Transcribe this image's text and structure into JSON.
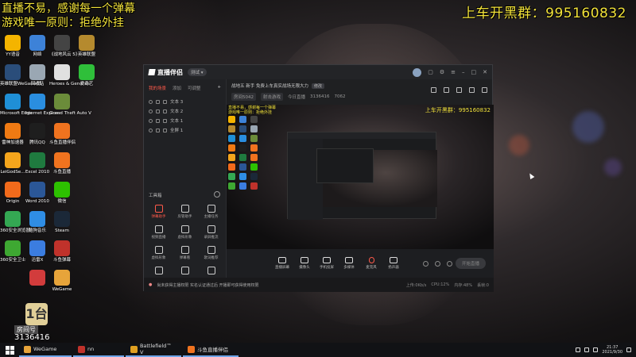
{
  "overlay": {
    "line1": "直播不易，感谢每一个弹幕",
    "line2": "游戏唯一原则：拒绝外挂",
    "group": "上车开黑群：995160832"
  },
  "desktop_icons": [
    {
      "label": "YY语音",
      "icon": "yy-icon",
      "color": "#f4b400"
    },
    {
      "label": "网络",
      "icon": "network-icon",
      "color": "#3d82d8"
    },
    {
      "label": "《战地风云 5》",
      "icon": "bf5-icon",
      "color": "#444444"
    },
    {
      "label": "英雄联盟",
      "icon": "lol-icon",
      "color": "#b58a2e"
    },
    {
      "label": "英雄联盟WeGame版",
      "icon": "lol-wegame-icon",
      "color": "#2a4d7a"
    },
    {
      "label": "回收站",
      "icon": "recycle-bin-icon",
      "color": "#9aa7b3"
    },
    {
      "label": "Heroes & Generals",
      "icon": "hg-icon",
      "color": "#e0e0e0"
    },
    {
      "label": "爱奇艺",
      "icon": "iqiyi-icon",
      "color": "#2fbf3a"
    },
    {
      "label": "Microsoft Edge",
      "icon": "edge-icon",
      "color": "#1f8fd6"
    },
    {
      "label": "Internet Explorer",
      "icon": "ie-icon",
      "color": "#2a8ee0"
    },
    {
      "label": "Grand Theft Auto V",
      "icon": "gta-icon",
      "color": "#6b8c3a"
    },
    {
      "label": "",
      "icon": "blank-icon",
      "color": "rgba(0,0,0,0)"
    },
    {
      "label": "雷神加速器",
      "icon": "leishen-icon",
      "color": "#f07a13"
    },
    {
      "label": "腾讯QQ",
      "icon": "qq-icon",
      "color": "#1e1e1e"
    },
    {
      "label": "斗鱼直播伴侣",
      "icon": "douyu-companion-icon",
      "color": "#f0731f"
    },
    {
      "label": "",
      "icon": "blank-icon",
      "color": "rgba(0,0,0,0)"
    },
    {
      "label": "LeiGodSe...",
      "icon": "leigod-icon",
      "color": "#f5a51c"
    },
    {
      "label": "Excel 2010",
      "icon": "excel-icon",
      "color": "#1f7a3f"
    },
    {
      "label": "斗鱼直播",
      "icon": "douyu-icon",
      "color": "#f0731f"
    },
    {
      "label": "",
      "icon": "blank-icon",
      "color": "rgba(0,0,0,0)"
    },
    {
      "label": "Origin",
      "icon": "origin-icon",
      "color": "#f26a1b"
    },
    {
      "label": "Word 2010",
      "icon": "word-icon",
      "color": "#2b5797"
    },
    {
      "label": "微信",
      "icon": "wechat-icon",
      "color": "#2dc100"
    },
    {
      "label": "",
      "icon": "blank-icon",
      "color": "rgba(0,0,0,0)"
    },
    {
      "label": "360安全浏览器",
      "icon": "360browser-icon",
      "color": "#34a853"
    },
    {
      "label": "酷狗音乐",
      "icon": "kugou-icon",
      "color": "#2f8de4"
    },
    {
      "label": "Steam",
      "icon": "steam-icon",
      "color": "#1b2838"
    },
    {
      "label": "",
      "icon": "blank-icon",
      "color": "rgba(0,0,0,0)"
    },
    {
      "label": "360安全卫士",
      "icon": "360safe-icon",
      "color": "#3ea832"
    },
    {
      "label": "迅雷X",
      "icon": "xunlei-icon",
      "color": "#3b7de0"
    },
    {
      "label": "斗鱼弹幕",
      "icon": "danmu-icon",
      "color": "#c0322b"
    },
    {
      "label": "",
      "icon": "blank-icon",
      "color": "rgba(0,0,0,0)"
    },
    {
      "label": "",
      "icon": "blank-icon",
      "color": "rgba(0,0,0,0)"
    },
    {
      "label": "",
      "icon": "gift-icon",
      "color": "#d23c3c"
    },
    {
      "label": "WeGame",
      "icon": "wegame-icon",
      "color": "#e7a43a"
    }
  ],
  "viewer_badge": {
    "logo": "1台",
    "name": "房间号",
    "number": "3136416"
  },
  "window": {
    "app_name": "直播伴侣",
    "version": "测试 ▾",
    "tabs": [
      "我的场景",
      "添加",
      "可调整"
    ],
    "scenes": [
      "文本 3",
      "文本 2",
      "文本 1",
      "全屏 1"
    ],
    "tools_title": "工具箱",
    "tools": [
      {
        "label": "弹幕助手",
        "icon": "danmu-tool-icon",
        "active": true
      },
      {
        "label": "房管助手",
        "icon": "admin-tool-icon",
        "active": false
      },
      {
        "label": "主播任务",
        "icon": "task-tool-icon",
        "active": false
      },
      {
        "label": "视频直播",
        "icon": "video-tool-icon",
        "active": false
      },
      {
        "label": "虚拟形象",
        "icon": "avatar-tool-icon",
        "active": false
      },
      {
        "label": "录屏推流",
        "icon": "record-tool-icon",
        "active": false
      },
      {
        "label": "虚拟形象",
        "icon": "virtual-tool-icon",
        "active": false
      },
      {
        "label": "弹幕看",
        "icon": "danmu-view-icon",
        "active": false
      },
      {
        "label": "歌词推荐",
        "icon": "lyrics-tool-icon",
        "active": false
      },
      {
        "label": "",
        "icon": "more-tool-icon",
        "active": false
      },
      {
        "label": "",
        "icon": "more-tool-icon",
        "active": false
      },
      {
        "label": "",
        "icon": "more-tool-icon",
        "active": false
      }
    ],
    "stream_title": "战地五 新手 免费上车真实战场无限大力",
    "stream_tag": "修改",
    "room_label": "房间5042",
    "category": "射击游戏",
    "viewers_label": "今日直播",
    "viewers": "3136416",
    "hot": "7062",
    "preview_overlay_l1": "直播不易，感谢每一个弹幕",
    "preview_overlay_l2": "游戏唯一原则：拒绝外挂",
    "preview_group": "上车开黑群：995160832",
    "toolbar": [
      {
        "label": "直播屏幕",
        "icon": "screen-icon"
      },
      {
        "label": "摄像头",
        "icon": "camera-icon"
      },
      {
        "label": "手机投屏",
        "icon": "phone-icon"
      },
      {
        "label": "多媒体",
        "icon": "media-icon"
      },
      {
        "label": "麦克风",
        "icon": "mic-icon"
      },
      {
        "label": "扬声器",
        "icon": "speaker-icon"
      }
    ],
    "start_button": "开始直播",
    "status_warn": "尚未获得主播权限 实名认证通过后 开播即可获得使用权限",
    "status_right": [
      "上传:0Kb/s",
      "CPU:12%",
      "内存:48%",
      "丢帧:0"
    ]
  },
  "taskbar": {
    "tasks": [
      {
        "label": "WeGame",
        "icon_color": "#e7a43a"
      },
      {
        "label": "nn",
        "icon_color": "#c0322b"
      },
      {
        "label": "Battlefield™ V",
        "icon_color": "#e0a020"
      },
      {
        "label": "斗鱼直播伴侣",
        "icon_color": "#f0731f"
      }
    ],
    "time": "21:37",
    "date": "2021/9/30"
  }
}
